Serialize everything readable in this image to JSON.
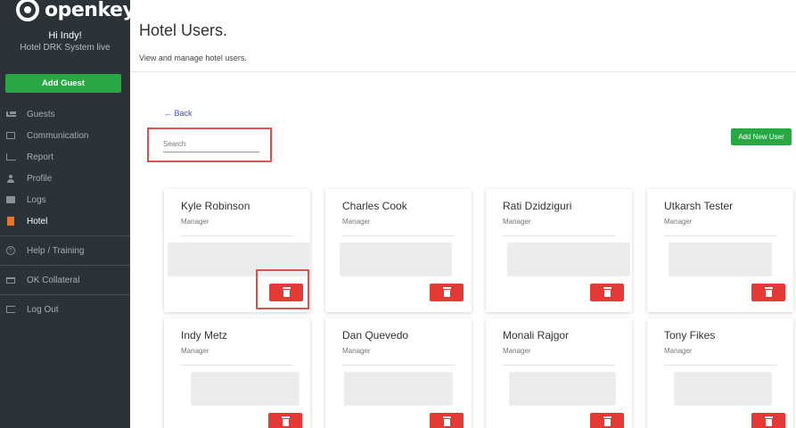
{
  "sidebar": {
    "logo_text": "openkey",
    "greeting": "Hi Indy!",
    "hotel_name": "Hotel DRK System live",
    "add_guest_label": "Add Guest",
    "items": [
      {
        "label": "Guests",
        "icon": "bed-icon"
      },
      {
        "label": "Communication",
        "icon": "envelope-icon"
      },
      {
        "label": "Report",
        "icon": "chart-icon"
      },
      {
        "label": "Profile",
        "icon": "user-icon"
      },
      {
        "label": "Logs",
        "icon": "logs-icon"
      },
      {
        "label": "Hotel",
        "icon": "hotel-icon",
        "active": true
      },
      {
        "label": "Help / Training",
        "icon": "help-icon"
      },
      {
        "label": "OK Collateral",
        "icon": "cart-icon"
      },
      {
        "label": "Log Out",
        "icon": "logout-icon"
      }
    ]
  },
  "header": {
    "title": "Hotel Users.",
    "subtitle": "View and manage hotel users."
  },
  "toolbar": {
    "back_label": "← Back",
    "search_placeholder": "Search",
    "add_user_label": "Add New User"
  },
  "users": [
    {
      "name": "Kyle Robinson",
      "role": "Manager"
    },
    {
      "name": "Charles Cook",
      "role": "Manager"
    },
    {
      "name": "Rati Dzidziguri",
      "role": "Manager"
    },
    {
      "name": "Utkarsh Tester",
      "role": "Manager"
    },
    {
      "name": "Indy Metz",
      "role": "Manager"
    },
    {
      "name": "Dan Quevedo",
      "role": "Manager"
    },
    {
      "name": "Monali Rajgor",
      "role": "Manager"
    },
    {
      "name": "Tony Fikes",
      "role": "Manager"
    }
  ],
  "colors": {
    "sidebar_bg": "#2b3238",
    "accent_green": "#28a745",
    "delete_red": "#e53935",
    "highlight_red": "#d9534f",
    "link_blue": "#3f51b5",
    "hotel_orange": "#e8742b"
  }
}
